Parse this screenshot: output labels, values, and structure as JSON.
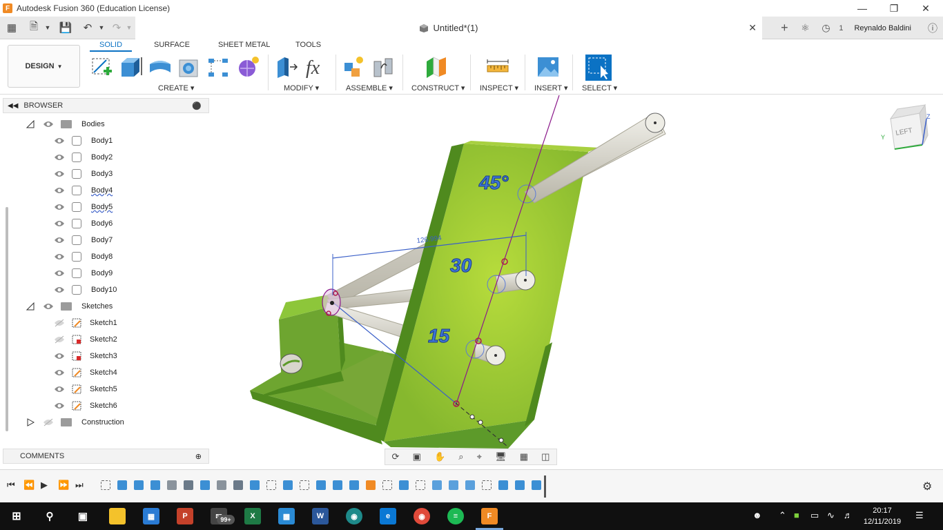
{
  "window": {
    "title": "Autodesk Fusion 360 (Education License)",
    "app_icon_letter": "F"
  },
  "docbar": {
    "document_name": "Untitled*(1)",
    "notification_count": "1",
    "user_name": "Reynaldo Baldini"
  },
  "ribbon": {
    "workspace": "DESIGN",
    "tabs": [
      "SOLID",
      "SURFACE",
      "SHEET METAL",
      "TOOLS"
    ],
    "active_tab": "SOLID",
    "groups": {
      "create": "CREATE",
      "modify": "MODIFY",
      "assemble": "ASSEMBLE",
      "construct": "CONSTRUCT",
      "inspect": "INSPECT",
      "insert": "INSERT",
      "select": "SELECT"
    }
  },
  "browser": {
    "title": "BROWSER",
    "bodies_folder": "Bodies",
    "bodies": [
      "Body1",
      "Body2",
      "Body3",
      "Body4",
      "Body5",
      "Body6",
      "Body7",
      "Body8",
      "Body9",
      "Body10"
    ],
    "sketches_folder": "Sketches",
    "sketches": [
      "Sketch1",
      "Sketch2",
      "Sketch3",
      "Sketch4",
      "Sketch5",
      "Sketch6"
    ],
    "construction_folder": "Construction"
  },
  "comments": {
    "title": "COMMENTS"
  },
  "viewport": {
    "dimension_label": "126.994",
    "angle_labels": [
      "45°",
      "30",
      "15"
    ],
    "viewcube_face": "LEFT",
    "viewcube_axis_z": "Z",
    "viewcube_axis_y": "Y"
  },
  "taskbar": {
    "time": "20:17",
    "date": "12/11/2019",
    "mail_badge": "99+"
  },
  "colors": {
    "accent": "#0b72c4",
    "model_green": "#8fc63a",
    "model_dark_green": "#4f8a1e",
    "sketch_line": "#8b1a8b",
    "dimension_blue": "#3a5fc8"
  }
}
